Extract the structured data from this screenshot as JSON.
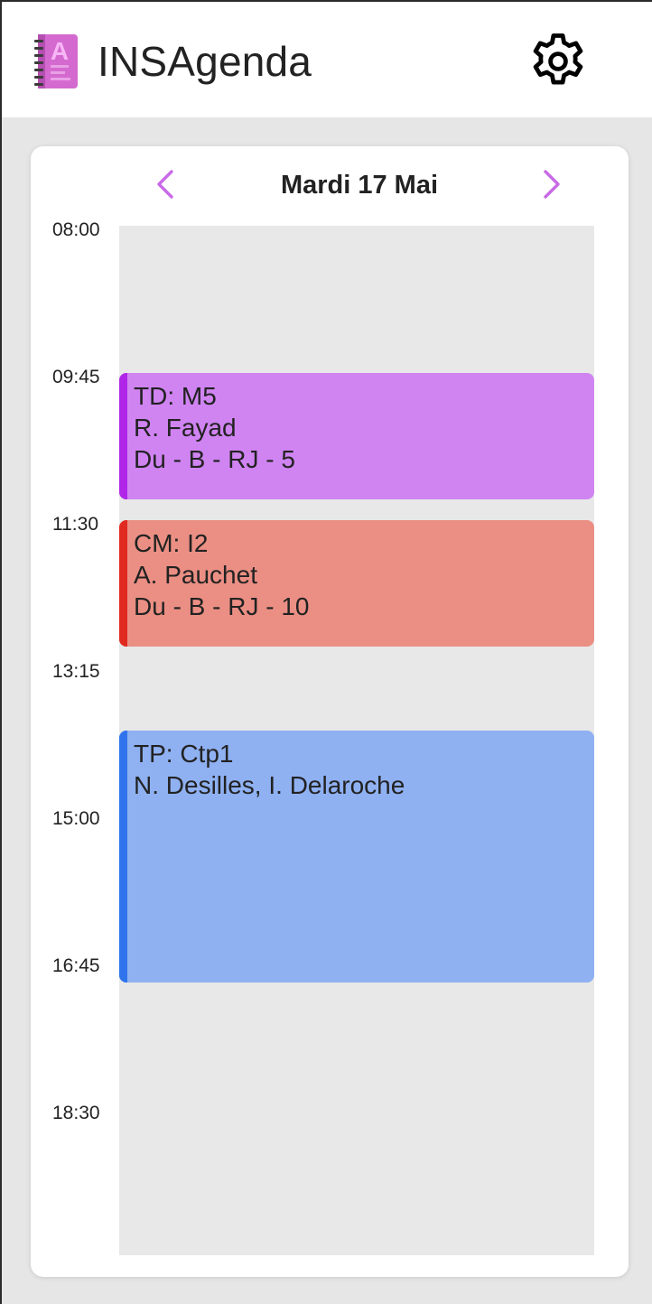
{
  "header": {
    "app_title": "INSAgenda",
    "logo_icon": "agenda-notebook-icon",
    "settings_icon": "gear-icon"
  },
  "day_view": {
    "date": "Mardi 17 Mai",
    "prev_icon": "chevron-left-icon",
    "next_icon": "chevron-right-icon",
    "accent_color": "#c86ae6",
    "time_labels": [
      "08:00",
      "09:45",
      "11:30",
      "13:15",
      "15:00",
      "16:45",
      "18:30"
    ]
  },
  "events": [
    {
      "title": "TD: M5",
      "teacher": "R. Fayad",
      "room": "Du - B - RJ - 5",
      "start": "09:45",
      "end": "11:15",
      "bg_color": "#d084f2",
      "bar_color": "#b026e8"
    },
    {
      "title": "CM: I2",
      "teacher": "A. Pauchet",
      "room": "Du - B - RJ - 10",
      "start": "11:30",
      "end": "13:00",
      "bg_color": "#eb8f84",
      "bar_color": "#e02a1f"
    },
    {
      "title": "TP: Ctp1",
      "teacher": "N. Desilles, I. Delaroche",
      "room": "",
      "start": "14:00",
      "end": "17:00",
      "bg_color": "#8fb1f2",
      "bar_color": "#2f74ec"
    }
  ]
}
